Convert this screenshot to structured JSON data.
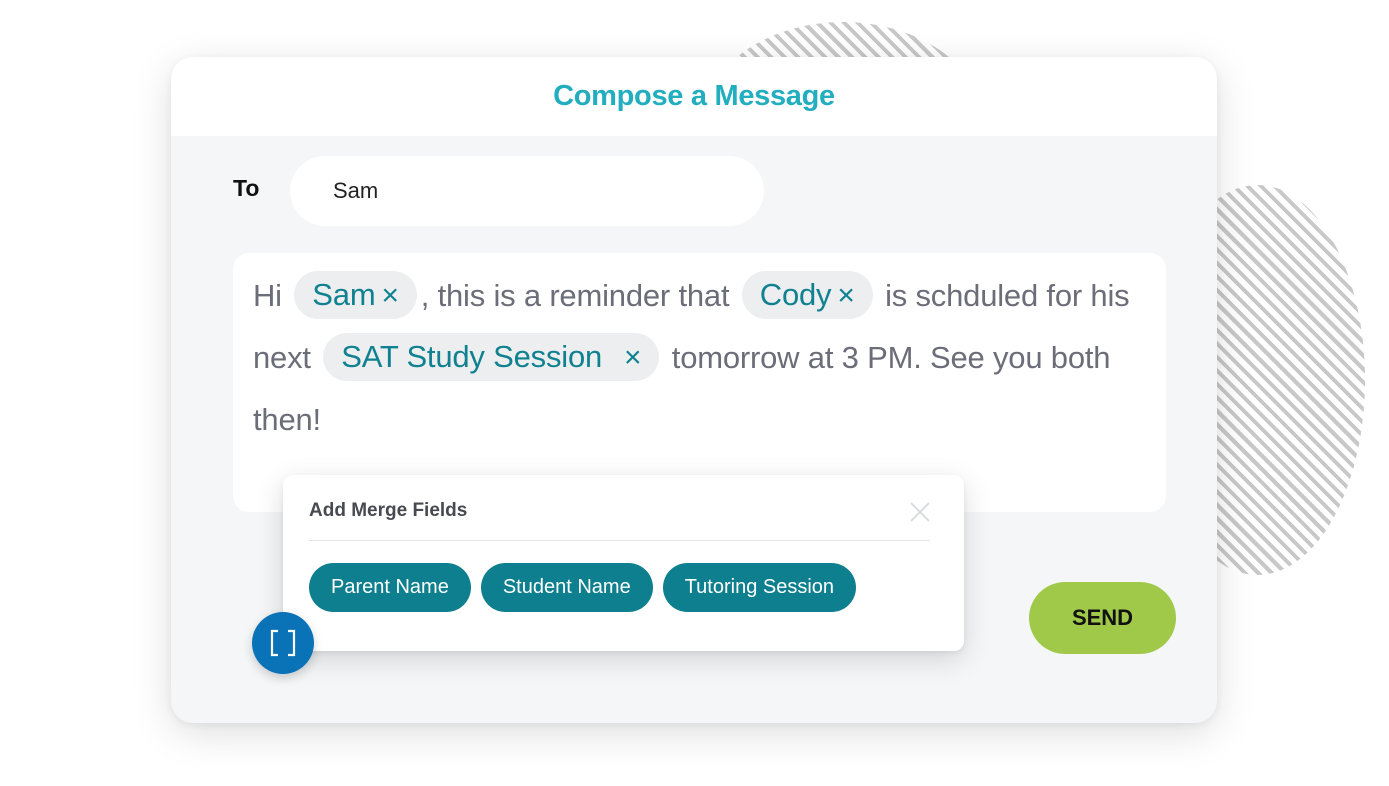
{
  "title": "Compose a Message",
  "to": {
    "label": "To",
    "value": "Sam"
  },
  "message": {
    "segments": {
      "t0": "Hi",
      "chip0": "Sam",
      "t1": ", this is a reminder that",
      "chip1": "Cody",
      "t2": "is schduled for his next",
      "chip2": "SAT Study Session",
      "t3": "tomorrow at 3 PM. See you both then!"
    },
    "chip_remove_glyph": "×"
  },
  "merge_popup": {
    "title": "Add Merge Fields",
    "fields": [
      "Parent Name",
      "Student Name",
      "Tutoring Session"
    ]
  },
  "send_label": "SEND",
  "colors": {
    "title": "#22aebf",
    "chip_text": "#108190",
    "merge_button": "#0e7f8e",
    "bracket_button": "#0a72b7",
    "send_button": "#a0c94a"
  }
}
